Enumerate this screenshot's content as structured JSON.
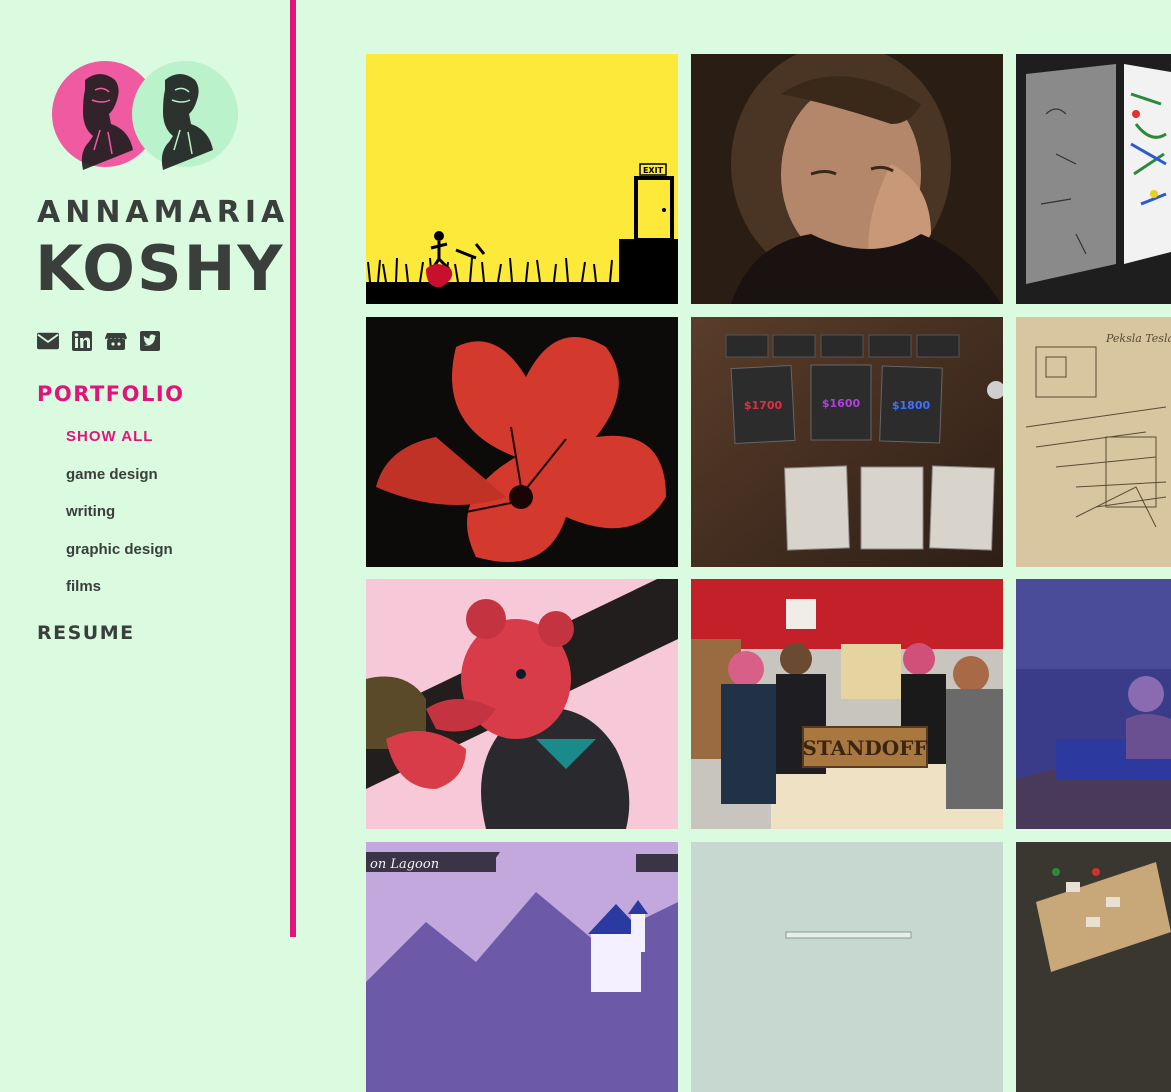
{
  "profile": {
    "first_name": "ANNAMARIA",
    "last_name": "KOSHY"
  },
  "socials": [
    {
      "icon": "envelope-icon"
    },
    {
      "icon": "linkedin-icon"
    },
    {
      "icon": "itchio-icon"
    },
    {
      "icon": "twitter-icon"
    }
  ],
  "nav": {
    "portfolio": "PORTFOLIO",
    "show_all": "SHOW ALL",
    "game_design": "game design",
    "writing": "writing",
    "graphic_design": "graphic design",
    "films": "films",
    "resume": "RESUME"
  },
  "tiles": {
    "exit_sign": "EXIT",
    "cards": [
      "$1700",
      "$1600",
      "$1800"
    ],
    "standoff": "STANDOFF",
    "lagoon": "on Lagoon"
  },
  "colors": {
    "background": "#dafbe0",
    "accent": "#e0157a",
    "text": "#3a3f3c"
  }
}
